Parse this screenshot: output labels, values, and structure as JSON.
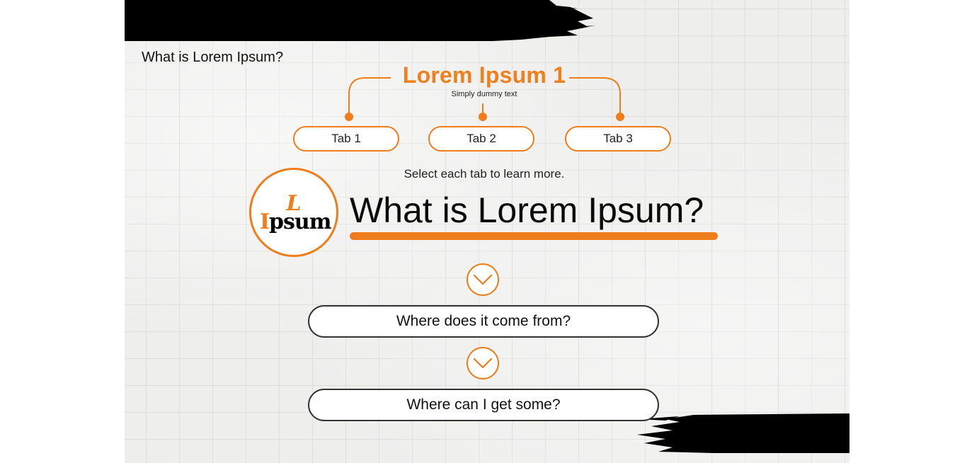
{
  "nav": {
    "title": "What is Lorem Ipsum?"
  },
  "hub": {
    "title": "Lorem Ipsum 1",
    "subtitle": "Simply dummy text"
  },
  "tabs": [
    {
      "label": "Tab 1"
    },
    {
      "label": "Tab 2"
    },
    {
      "label": "Tab 3"
    }
  ],
  "instruction": "Select each tab to learn more.",
  "logo": {
    "letter": "L",
    "word_first": "I",
    "word_rest": "psum"
  },
  "heading": "What is Lorem Ipsum?",
  "questions": [
    {
      "label": "Where does it come from?"
    },
    {
      "label": "Where can I get some?"
    }
  ],
  "icons": {
    "expand": "chevron-down-icon"
  },
  "colors": {
    "accent": "#ef7d1b",
    "text": "#111111",
    "brush": "#000000"
  }
}
